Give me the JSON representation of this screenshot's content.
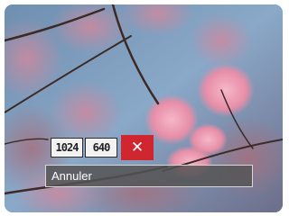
{
  "resize_options": [
    {
      "label": "1024",
      "icon": "resize-1024-icon"
    },
    {
      "label": "640",
      "icon": "resize-640-icon"
    }
  ],
  "cancel_option": {
    "icon": "close-icon",
    "glyph": "✕",
    "color": "#d02630"
  },
  "selected_option_label": "Annuler",
  "colors": {
    "sky": "#7f9fbd",
    "blossom": "#e58aa5",
    "branch": "#3b2a26",
    "label_bar": "#555555"
  }
}
